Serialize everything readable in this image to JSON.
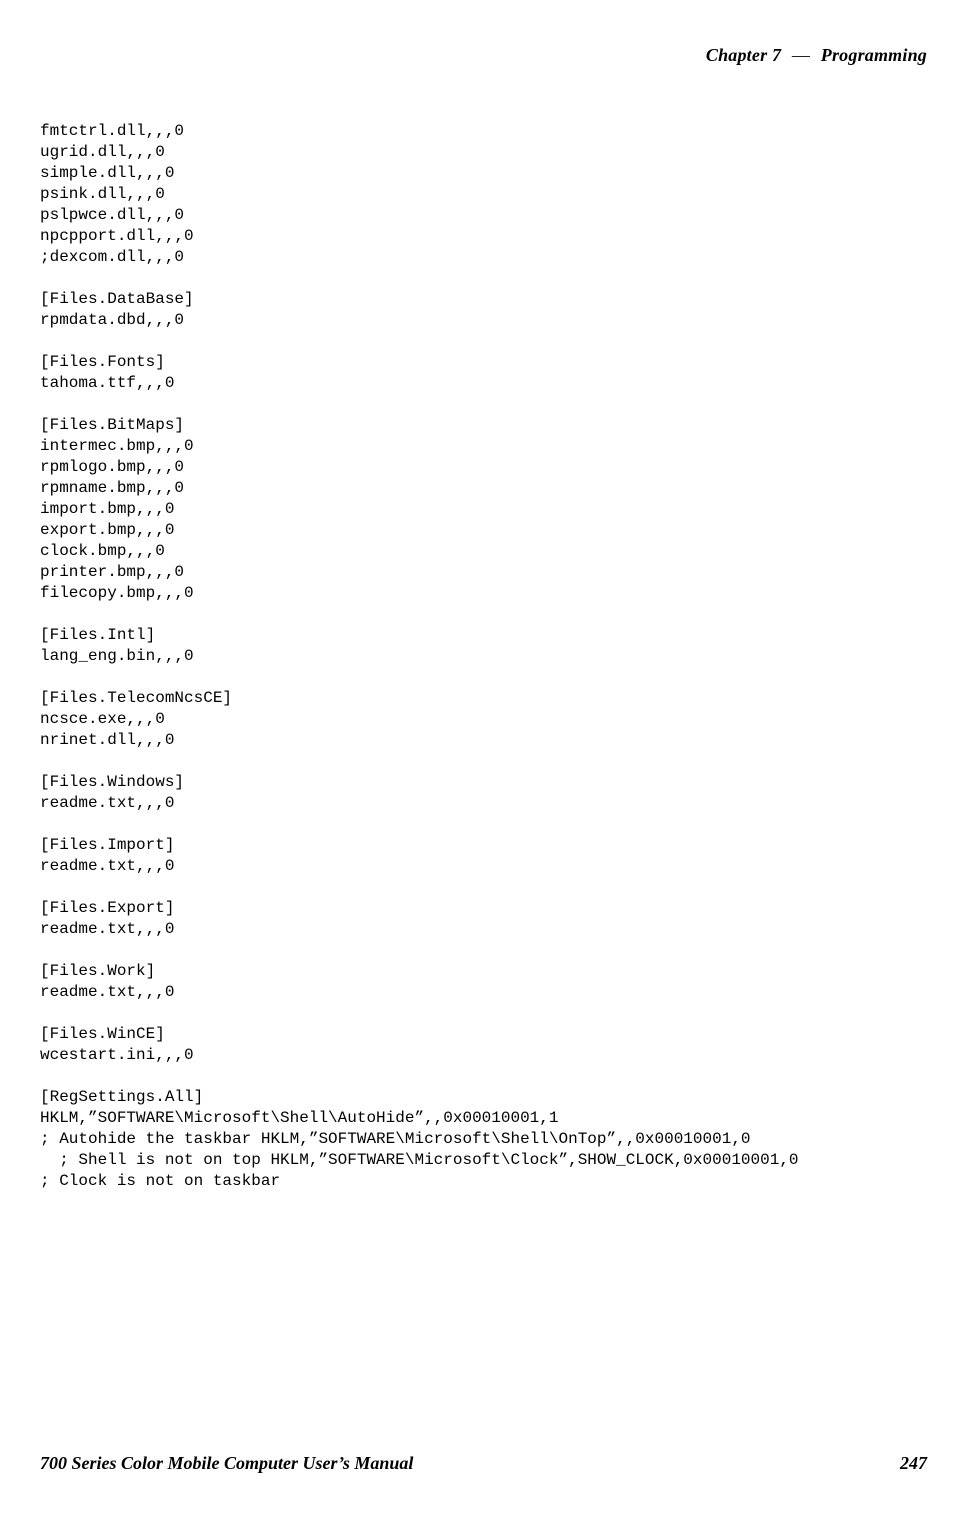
{
  "header": {
    "chapter_label": "Chapter 7",
    "section_label": "Programming"
  },
  "body": {
    "lines": [
      "fmtctrl.dll,,,0",
      "ugrid.dll,,,0",
      "simple.dll,,,0",
      "psink.dll,,,0",
      "pslpwce.dll,,,0",
      "npcpport.dll,,,0",
      ";dexcom.dll,,,0",
      "",
      "[Files.DataBase]",
      "rpmdata.dbd,,,0",
      "",
      "[Files.Fonts]",
      "tahoma.ttf,,,0",
      "",
      "[Files.BitMaps]",
      "intermec.bmp,,,0",
      "rpmlogo.bmp,,,0",
      "rpmname.bmp,,,0",
      "import.bmp,,,0",
      "export.bmp,,,0",
      "clock.bmp,,,0",
      "printer.bmp,,,0",
      "filecopy.bmp,,,0",
      "",
      "[Files.Intl]",
      "lang_eng.bin,,,0",
      "",
      "[Files.TelecomNcsCE]",
      "ncsce.exe,,,0",
      "nrinet.dll,,,0",
      "",
      "[Files.Windows]",
      "readme.txt,,,0",
      "",
      "[Files.Import]",
      "readme.txt,,,0",
      "",
      "[Files.Export]",
      "readme.txt,,,0",
      "",
      "[Files.Work]",
      "readme.txt,,,0",
      "",
      "[Files.WinCE]",
      "wcestart.ini,,,0",
      "",
      "[RegSettings.All]",
      "HKLM,”SOFTWARE\\Microsoft\\Shell\\AutoHide”,,0x00010001,1",
      "; Autohide the taskbar HKLM,”SOFTWARE\\Microsoft\\Shell\\OnTop”,,0x00010001,0",
      "  ; Shell is not on top HKLM,”SOFTWARE\\Microsoft\\Clock”,SHOW_CLOCK,0x00010001,0",
      "; Clock is not on taskbar"
    ]
  },
  "footer": {
    "manual_title": "700 Series Color Mobile Computer User’s Manual",
    "page_number": "247"
  }
}
